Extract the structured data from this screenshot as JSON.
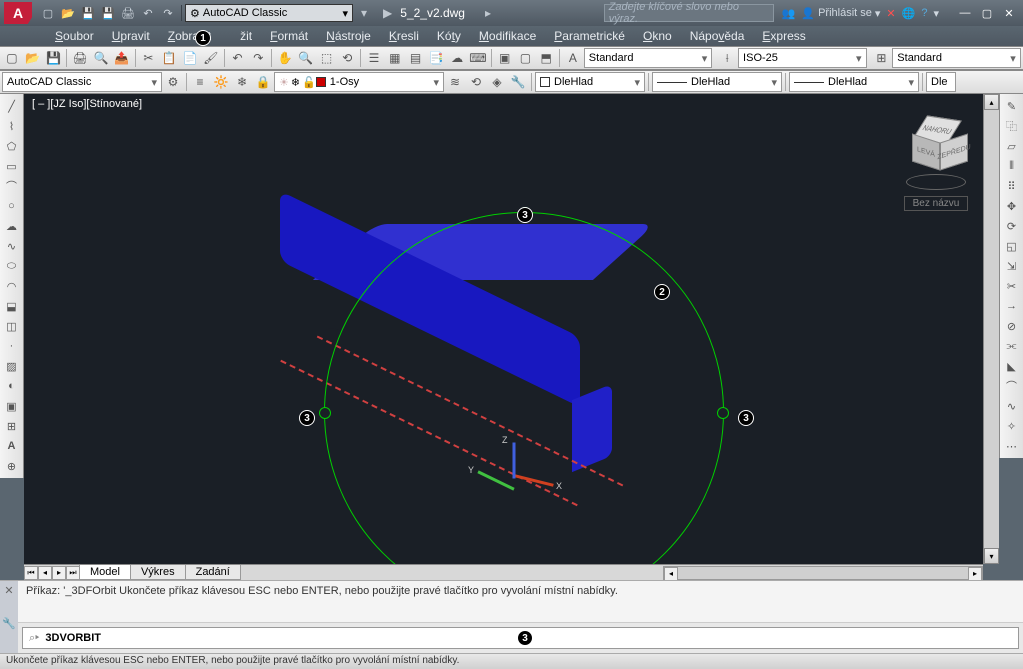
{
  "titlebar": {
    "workspace": "AutoCAD Classic",
    "filename": "5_2_v2.dwg",
    "search_placeholder": "Zadejte klíčové slovo nebo výraz.",
    "signin": "Přihlásit se"
  },
  "menus": {
    "soubor": "Soubor",
    "upravit": "Upravit",
    "zobrazit": "Zobrazit",
    "vlozit": "žit",
    "format": "Formát",
    "nastroje": "Nástroje",
    "kresli": "Kresli",
    "koty": "Kóty",
    "modifikace": "Modifikace",
    "parametricke": "Parametrické",
    "okno": "Okno",
    "napoveda": "Nápověda",
    "express": "Express"
  },
  "toolbars": {
    "workspace2": "AutoCAD Classic",
    "layer": "1-Osy",
    "textstyle": "Standard",
    "dimstyle": "ISO-25",
    "tablestyle": "Standard",
    "color": "DleHlad",
    "ltype": "DleHlad",
    "lweight": "DleHlad",
    "dle": "Dle"
  },
  "viewport": {
    "label": "[ – ][JZ Iso][Stínované]",
    "viewcube_label": "Bez názvu",
    "cube_top": "NAHORU",
    "cube_front": "LEVÁ",
    "cube_right": "ZEPŘEDU",
    "axis_x": "X",
    "axis_y": "Y",
    "axis_z": "Z"
  },
  "callouts": {
    "c1": "1",
    "c2_top": "3",
    "c2_right": "2",
    "c3_left": "3",
    "c3_right": "3",
    "c3_bot": "3"
  },
  "tabs": {
    "model": "Model",
    "vykres": "Výkres",
    "zadani": "Zadání"
  },
  "command": {
    "history": "Příkaz: '_3DFOrbit Ukončete příkaz klávesou ESC nebo ENTER, nebo použijte pravé tlačítko pro vyvolání místní nabídky.",
    "current": "3DVORBIT"
  },
  "statusbar": {
    "text": "Ukončete příkaz klávesou ESC nebo ENTER, nebo použijte pravé tlačítko pro vyvolání místní nabídky."
  }
}
